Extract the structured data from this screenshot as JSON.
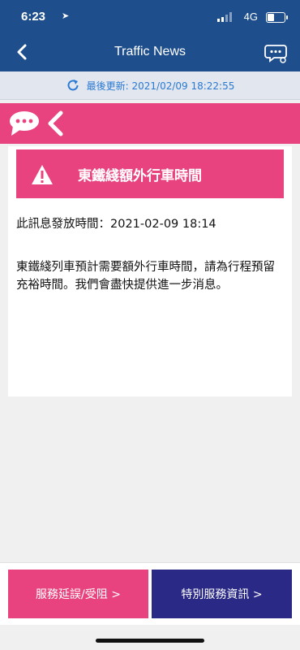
{
  "status_bar": {
    "time": "6:23",
    "network": "4G"
  },
  "nav": {
    "title": "Traffic News"
  },
  "update": {
    "text": "最後更新: 2021/02/09 18:22:55"
  },
  "alert": {
    "title": "東鐵綫額外行車時間",
    "issued": "此訊息發放時間：2021-02-09 18:14",
    "body": "東鐵綫列車預計需要額外行車時間，請為行程預留充裕時間。我們會盡快提供進一步消息。"
  },
  "buttons": {
    "delay": "服務延誤/受阻 >",
    "special": "特別服務資訊 >"
  },
  "colors": {
    "navy": "#1e4f8c",
    "pink": "#e8437e",
    "indigo": "#2a2a86",
    "link_blue": "#2a7ad3"
  },
  "icons": [
    "back-chevron-icon",
    "chat-support-icon",
    "refresh-icon",
    "speech-bubble-icon",
    "chevron-left-icon",
    "warning-icon"
  ]
}
